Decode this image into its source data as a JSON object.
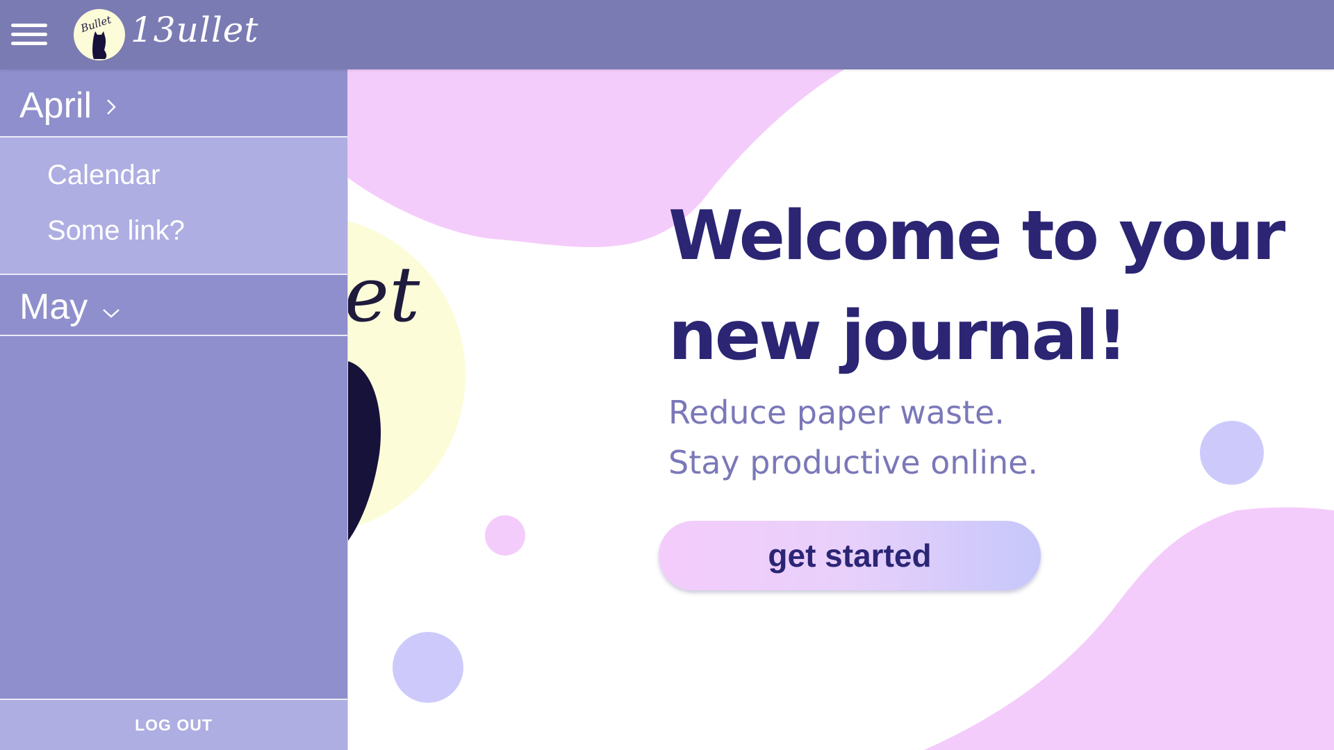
{
  "app": {
    "brand_name": "13ullet",
    "logo_badge_text": "Bullet"
  },
  "header": {
    "menu_icon": "hamburger-menu-icon"
  },
  "sidebar": {
    "months": [
      {
        "label": "April",
        "state": "collapsed",
        "chevron": "chevron-right-icon"
      },
      {
        "label": "May",
        "state": "expanded",
        "chevron": "chevron-down-icon"
      }
    ],
    "links": [
      {
        "label": "Calendar"
      },
      {
        "label": "Some link?"
      }
    ],
    "logout_label": "LOG OUT"
  },
  "hero": {
    "title_line1": "Welcome to your",
    "title_line2": "new journal!",
    "subtitle_line1": "Reduce paper waste.",
    "subtitle_line2": "Stay productive online.",
    "cta_label": "get started",
    "background_logo_text": "et"
  },
  "colors": {
    "topbar": "#7b7bb3",
    "sidebar": "#8f8fcd",
    "submenu": "#aeaee2",
    "title": "#2b2574",
    "subtitle": "#7a78b8",
    "blob_pink": "#f4ccfb",
    "blob_lavender": "#cdcafb",
    "logo_circle": "#fdfcd9"
  }
}
